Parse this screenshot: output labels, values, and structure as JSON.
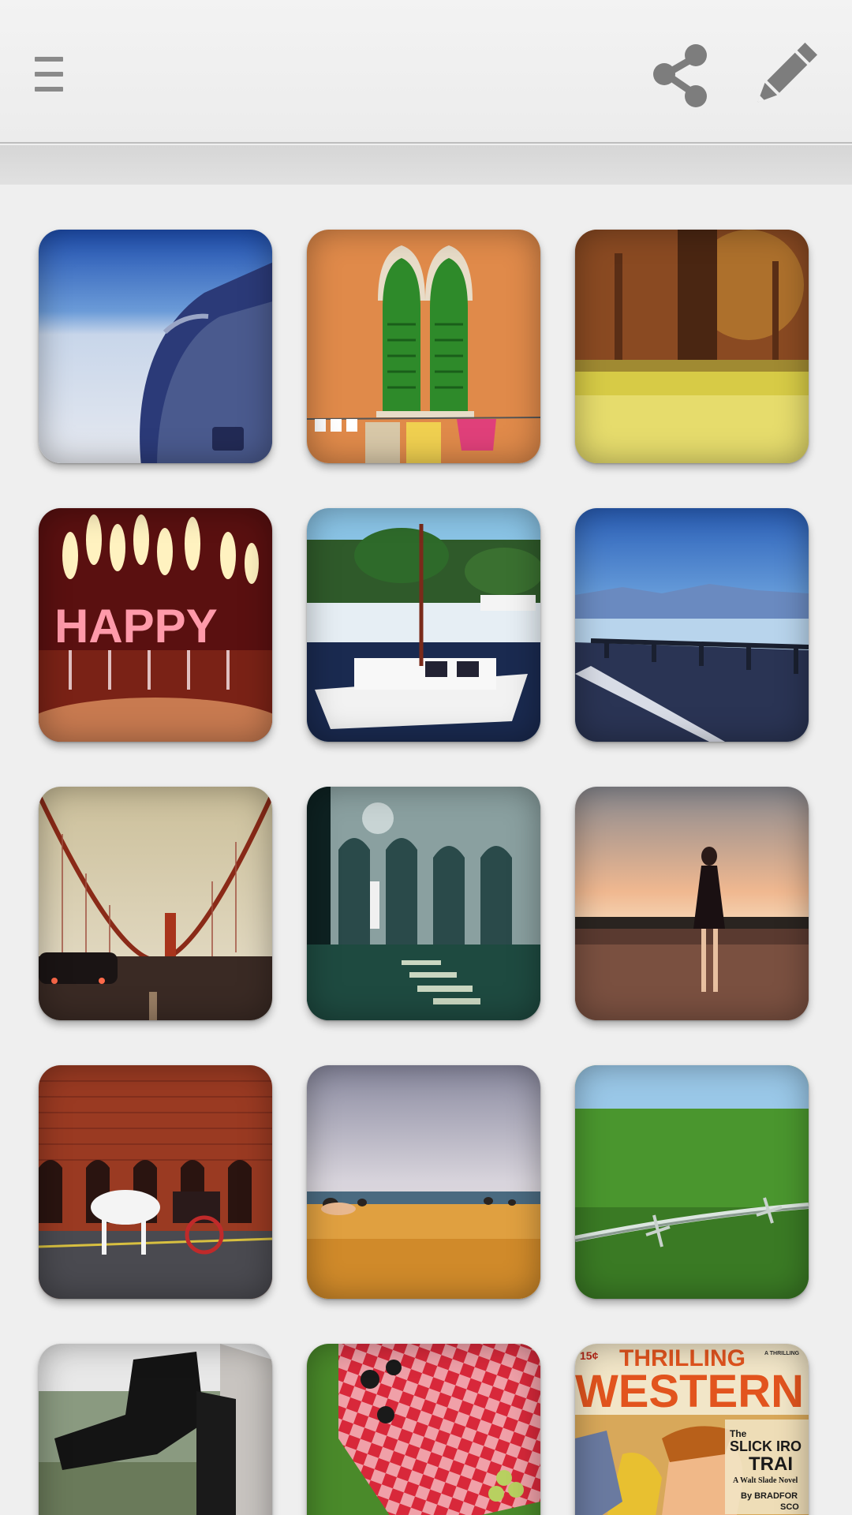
{
  "toolbar": {
    "menu_icon": "hamburger-menu-icon",
    "share_icon": "share-icon",
    "edit_icon": "pencil-icon"
  },
  "photos": [
    {
      "subject": "airplane-wing-over-clouds"
    },
    {
      "subject": "green-shuttered-windows"
    },
    {
      "subject": "park-tree-grass"
    },
    {
      "subject": "birthday-candles",
      "caption": "HAPPY"
    },
    {
      "subject": "boats-in-harbor"
    },
    {
      "subject": "lake-road-mountains"
    },
    {
      "subject": "golden-gate-bridge-rain"
    },
    {
      "subject": "cloister-wedding"
    },
    {
      "subject": "woman-at-sunset"
    },
    {
      "subject": "horse-carriage-brick-building"
    },
    {
      "subject": "beach-pebbles"
    },
    {
      "subject": "barbed-wire-field"
    },
    {
      "subject": "riding-boots"
    },
    {
      "subject": "picnic-blanket"
    },
    {
      "subject": "western-magazine-cover",
      "price": "15¢",
      "title": "THRILLING",
      "title2": "WESTERN",
      "story1": "SLICK IRO",
      "story2": "TRAI",
      "byline": "By BRADFOR",
      "byline2": "SCO",
      "small": "A Walt Slade Novel"
    }
  ]
}
